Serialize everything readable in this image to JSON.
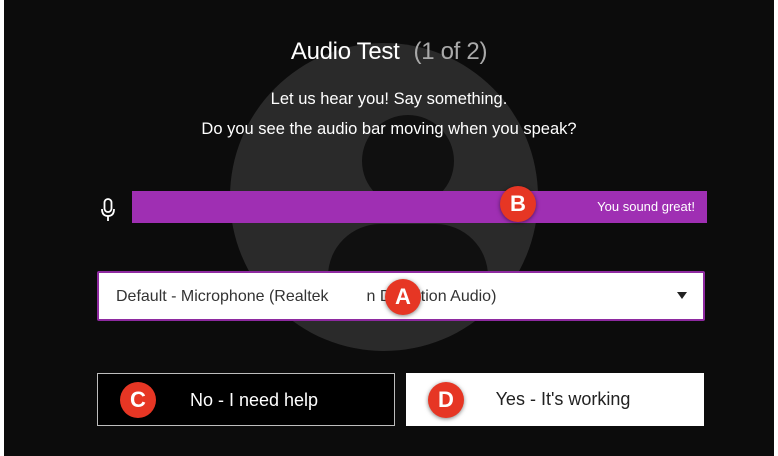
{
  "dialog": {
    "title": "Audio Test",
    "step": "(1 of 2)",
    "instruction_line1": "Let us hear you! Say something.",
    "instruction_line2": "Do you see the audio bar moving when you speak?"
  },
  "audio_meter": {
    "icon": "microphone-icon",
    "status_text": "You sound great!",
    "color": "#9f2fb3"
  },
  "device_select": {
    "selected_value": "Default - Microphone (Realtek High Definition Audio)",
    "visible_left": "Default - Microphone (Realtek",
    "visible_right": "n Definition Audio)",
    "border_color": "#8e2aa0"
  },
  "buttons": {
    "no_label": "No - I need help",
    "yes_label": "Yes - It's working"
  },
  "annotations": {
    "a": "A",
    "b": "B",
    "c": "C",
    "d": "D",
    "color": "#e63624"
  }
}
